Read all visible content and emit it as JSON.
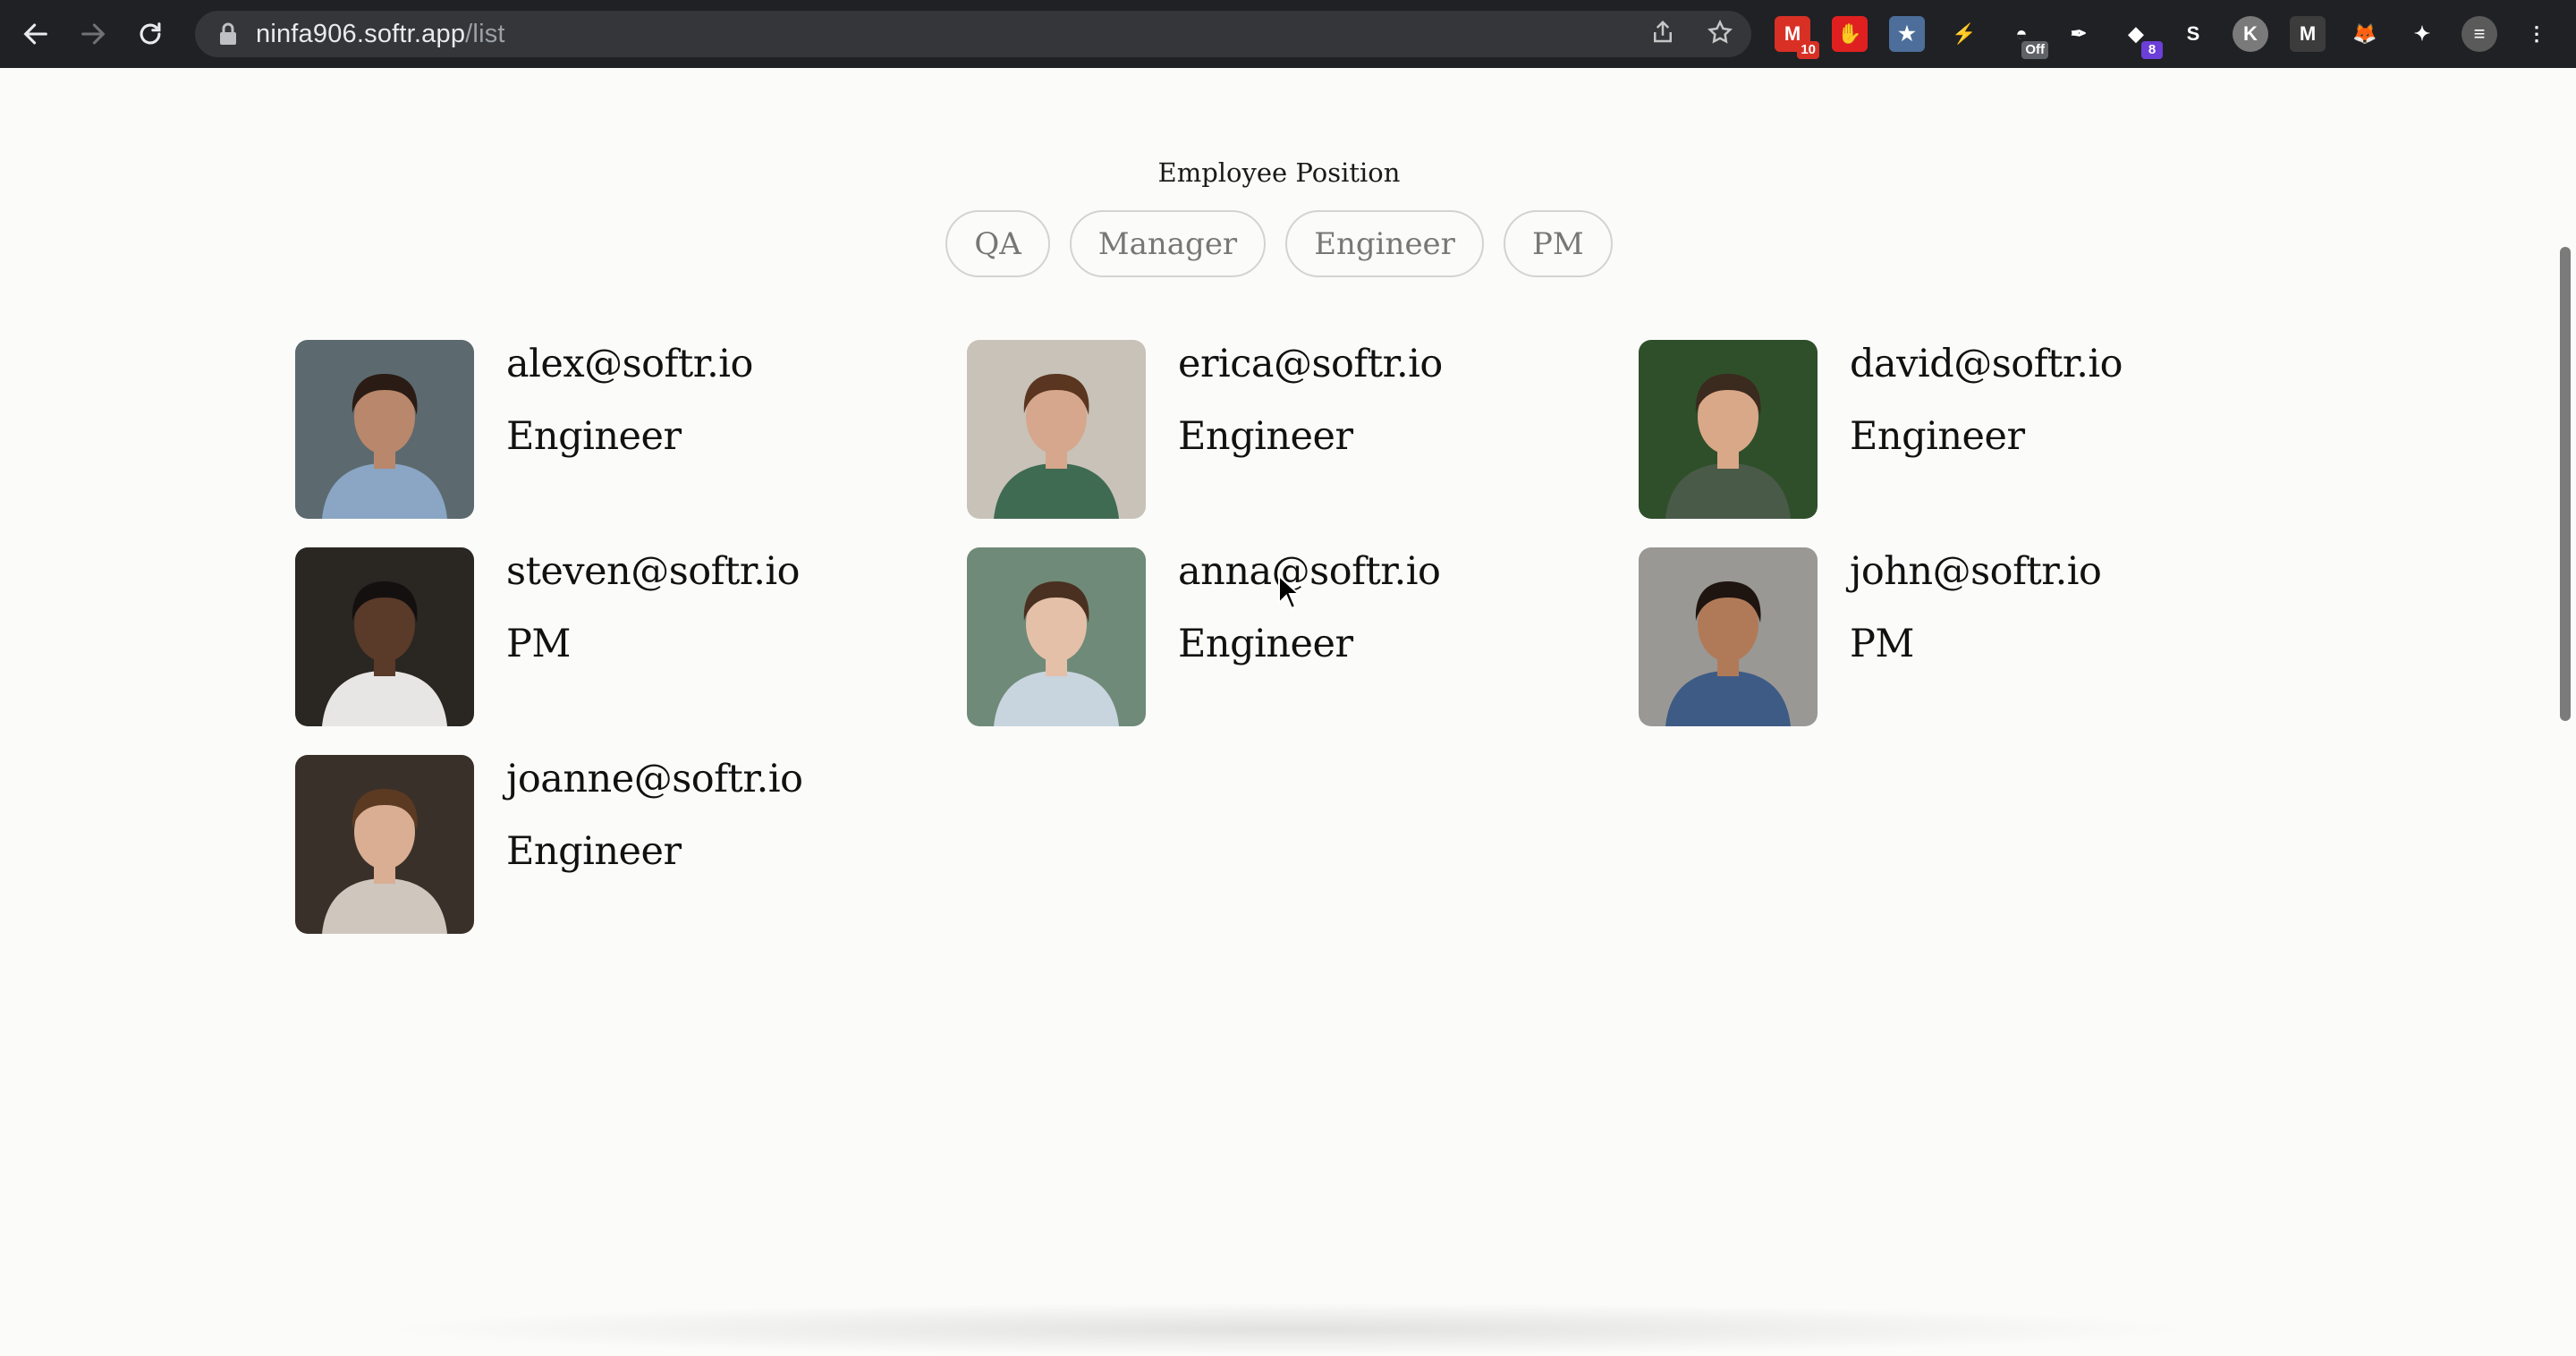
{
  "browser": {
    "url_host": "ninfa906.softr.app",
    "url_path": "/list",
    "extensions": [
      {
        "name": "gmail-ext",
        "glyph": "M",
        "bg": "#d93025",
        "badge": "10",
        "badge_bg": "#d93025"
      },
      {
        "name": "adblock-ext",
        "glyph": "✋",
        "bg": "#e02020"
      },
      {
        "name": "star-ext",
        "glyph": "★",
        "bg": "#4d6e9a"
      },
      {
        "name": "bolt-ext",
        "glyph": "⚡",
        "bg": "transparent"
      },
      {
        "name": "hat-ext",
        "glyph": "◓",
        "bg": "transparent",
        "badge": "Off",
        "badge_bg": "#5f6368"
      },
      {
        "name": "feather-ext",
        "glyph": "✒",
        "bg": "transparent"
      },
      {
        "name": "cube-ext",
        "glyph": "◆",
        "bg": "transparent",
        "badge": "8",
        "badge_bg": "#6b3fd8"
      },
      {
        "name": "seo-ext",
        "glyph": "S",
        "bg": "transparent"
      },
      {
        "name": "k-ext",
        "glyph": "K",
        "bg": "#7a7a7a"
      },
      {
        "name": "m-ext",
        "glyph": "M",
        "bg": "#3c3c3c"
      },
      {
        "name": "fox-ext",
        "glyph": "🦊",
        "bg": "transparent"
      },
      {
        "name": "puzzle-icon",
        "glyph": "✦",
        "bg": "transparent"
      },
      {
        "name": "profile-avatar",
        "glyph": "≡",
        "bg": "#5a5a5a"
      },
      {
        "name": "menu-icon",
        "glyph": "⋮",
        "bg": "transparent"
      }
    ]
  },
  "filter": {
    "title": "Employee Position",
    "options": [
      "QA",
      "Manager",
      "Engineer",
      "PM"
    ]
  },
  "employees": [
    {
      "email": "alex@softr.io",
      "position": "Engineer",
      "photo": {
        "bg": "#5c6a6f",
        "skin": "#b9876b",
        "hair": "#2a1c14",
        "shirt": "#8aa6c4"
      }
    },
    {
      "email": "erica@softr.io",
      "position": "Engineer",
      "photo": {
        "bg": "#c8c2b8",
        "skin": "#d6a78c",
        "hair": "#5a3520",
        "shirt": "#3f6b52"
      }
    },
    {
      "email": "david@softr.io",
      "position": "Engineer",
      "photo": {
        "bg": "#2f4f2a",
        "skin": "#d9a888",
        "hair": "#3b2a1e",
        "shirt": "#4a5a48"
      }
    },
    {
      "email": "steven@softr.io",
      "position": "PM",
      "photo": {
        "bg": "#2a2622",
        "skin": "#5a3a28",
        "hair": "#151010",
        "shirt": "#e8e6e4"
      }
    },
    {
      "email": "anna@softr.io",
      "position": "Engineer",
      "photo": {
        "bg": "#6f8a78",
        "skin": "#e4c0a8",
        "hair": "#4a3020",
        "shirt": "#c8d4de"
      }
    },
    {
      "email": "john@softr.io",
      "position": "PM",
      "photo": {
        "bg": "#9a9894",
        "skin": "#b07a58",
        "hair": "#1e1410",
        "shirt": "#3e5b86"
      }
    },
    {
      "email": "joanne@softr.io",
      "position": "Engineer",
      "photo": {
        "bg": "#3a302a",
        "skin": "#d9ae92",
        "hair": "#5c3a22",
        "shirt": "#cfc6be"
      }
    }
  ]
}
